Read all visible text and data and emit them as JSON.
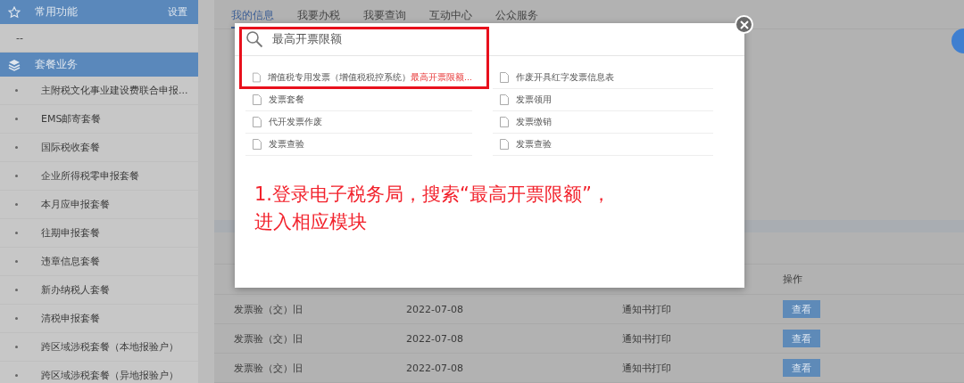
{
  "sidebar": {
    "favorites": {
      "title": "常用功能",
      "settings": "设置",
      "items": [
        "--"
      ]
    },
    "packages": {
      "title": "套餐业务",
      "items": [
        "主附税文化事业建设费联合申报...",
        "EMS邮寄套餐",
        "国际税收套餐",
        "企业所得税零申报套餐",
        "本月应申报套餐",
        "往期申报套餐",
        "违章信息套餐",
        "新办纳税人套餐",
        "清税申报套餐",
        "跨区域涉税套餐（本地报验户）",
        "跨区域涉税套餐（异地报验户）"
      ]
    }
  },
  "tabs": [
    {
      "label": "我的信息",
      "selected": true
    },
    {
      "label": "我要办税",
      "selected": false
    },
    {
      "label": "我要查询",
      "selected": false
    },
    {
      "label": "互动中心",
      "selected": false
    },
    {
      "label": "公众服务",
      "selected": false
    }
  ],
  "table": {
    "columns": [
      {
        "label": "操作"
      }
    ],
    "rows": [
      {
        "cells": [
          "发票验（交）旧",
          "2022-07-08",
          "通知书打印"
        ],
        "action": "查看"
      },
      {
        "cells": [
          "发票验（交）旧",
          "2022-07-08",
          "通知书打印"
        ],
        "action": "查看"
      },
      {
        "cells": [
          "发票验（交）旧",
          "2022-07-08",
          "通知书打印"
        ],
        "action": "查看"
      }
    ]
  },
  "search_dialog": {
    "search": {
      "value": "最高开票限额"
    },
    "result_columns": [
      {
        "items": [
          {
            "text": "增值税专用发票（增值税税控系统）",
            "match": "最高开票限额..."
          },
          {
            "text": "发票套餐"
          },
          {
            "text": "代开发票作废"
          },
          {
            "text": "发票查验"
          }
        ]
      },
      {
        "items": [
          {
            "text": "作废开具红字发票信息表"
          },
          {
            "text": "发票领用"
          },
          {
            "text": "发票缴销"
          },
          {
            "text": "发票查验"
          }
        ]
      }
    ],
    "annotation": [
      "1.登录电子税务局，搜索“最高开票限额”，",
      "进入相应模块"
    ]
  }
}
